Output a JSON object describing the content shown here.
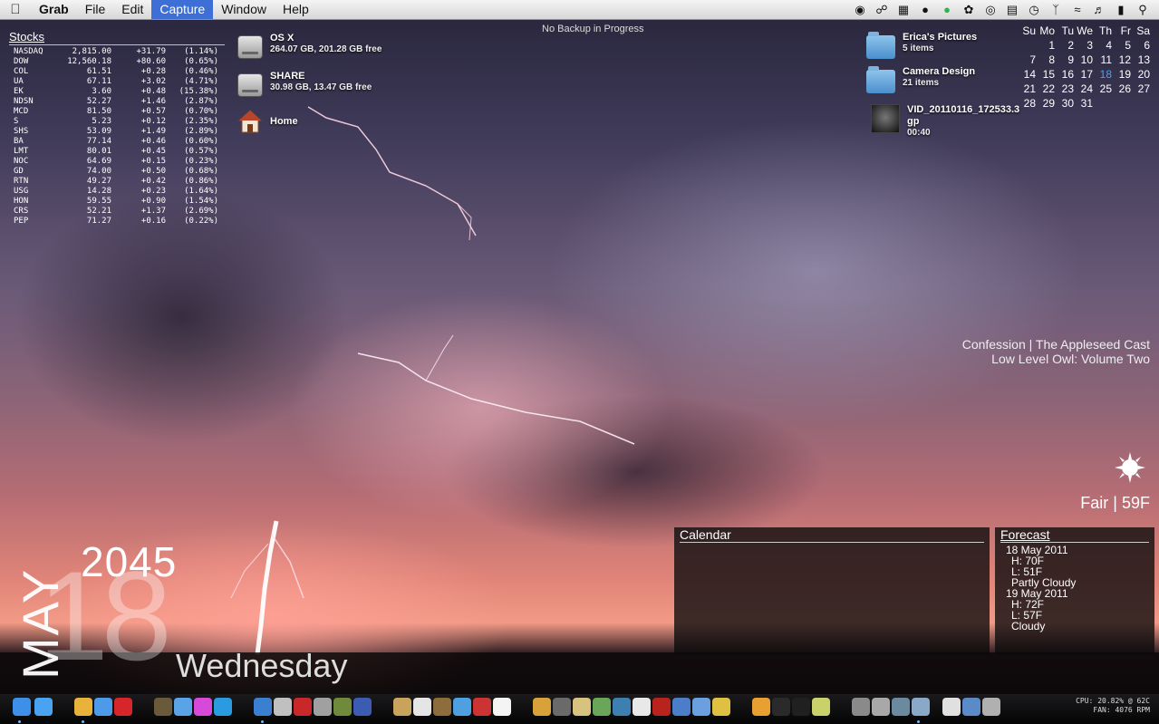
{
  "menubar": {
    "items": [
      "Grab",
      "File",
      "Edit",
      "Capture",
      "Window",
      "Help"
    ],
    "active_item": "Capture"
  },
  "backup_status": "No Backup in Progress",
  "stocks": {
    "title": "Stocks",
    "rows": [
      {
        "symbol": "NASDAQ",
        "price": "2,815.00",
        "change": "+31.79",
        "percent": "(1.14%)"
      },
      {
        "symbol": "DOW",
        "price": "12,560.18",
        "change": "+80.60",
        "percent": "(0.65%)"
      },
      {
        "symbol": "COL",
        "price": "61.51",
        "change": "+0.28",
        "percent": "(0.46%)"
      },
      {
        "symbol": "UA",
        "price": "67.11",
        "change": "+3.02",
        "percent": "(4.71%)"
      },
      {
        "symbol": "EK",
        "price": "3.60",
        "change": "+0.48",
        "percent": "(15.38%)"
      },
      {
        "symbol": "NDSN",
        "price": "52.27",
        "change": "+1.46",
        "percent": "(2.87%)"
      },
      {
        "symbol": "MCD",
        "price": "81.50",
        "change": "+0.57",
        "percent": "(0.70%)"
      },
      {
        "symbol": "S",
        "price": "5.23",
        "change": "+0.12",
        "percent": "(2.35%)"
      },
      {
        "symbol": "SHS",
        "price": "53.09",
        "change": "+1.49",
        "percent": "(2.89%)"
      },
      {
        "symbol": "BA",
        "price": "77.14",
        "change": "+0.46",
        "percent": "(0.60%)"
      },
      {
        "symbol": "LMT",
        "price": "80.01",
        "change": "+0.45",
        "percent": "(0.57%)"
      },
      {
        "symbol": "NOC",
        "price": "64.69",
        "change": "+0.15",
        "percent": "(0.23%)"
      },
      {
        "symbol": "GD",
        "price": "74.00",
        "change": "+0.50",
        "percent": "(0.68%)"
      },
      {
        "symbol": "RTN",
        "price": "49.27",
        "change": "+0.42",
        "percent": "(0.86%)"
      },
      {
        "symbol": "USG",
        "price": "14.28",
        "change": "+0.23",
        "percent": "(1.64%)"
      },
      {
        "symbol": "HON",
        "price": "59.55",
        "change": "+0.90",
        "percent": "(1.54%)"
      },
      {
        "symbol": "CRS",
        "price": "52.21",
        "change": "+1.37",
        "percent": "(2.69%)"
      },
      {
        "symbol": "PEP",
        "price": "71.27",
        "change": "+0.16",
        "percent": "(0.22%)"
      }
    ]
  },
  "desktop": {
    "osx": {
      "name": "OS X",
      "info": "264.07 GB, 201.28 GB free"
    },
    "share": {
      "name": "SHARE",
      "info": "30.98 GB, 13.47 GB free"
    },
    "home": {
      "name": "Home"
    },
    "ericas_pictures": {
      "name": "Erica's Pictures",
      "info": "5 items"
    },
    "camera_design": {
      "name": "Camera Design",
      "info": "21 items"
    },
    "video": {
      "name": "VID_20110116_172533.3gp",
      "info": "00:40"
    }
  },
  "calendar_grid": {
    "headers": [
      "Su",
      "Mo",
      "Tu",
      "We",
      "Th",
      "Fr",
      "Sa"
    ],
    "days": [
      "",
      "1",
      "2",
      "3",
      "4",
      "5",
      "6",
      "7",
      "8",
      "9",
      "10",
      "11",
      "12",
      "13",
      "14",
      "15",
      "16",
      "17",
      "18",
      "19",
      "20",
      "21",
      "22",
      "23",
      "24",
      "25",
      "26",
      "27",
      "28",
      "29",
      "30",
      "31"
    ],
    "today": "18",
    "today_color": "#39a7ff"
  },
  "now_playing": {
    "line1": "Confession | The Appleseed Cast",
    "line2": "Low Level Owl: Volume Two"
  },
  "weather": {
    "text": "Fair | 59F",
    "icon": "sun-icon"
  },
  "calendar_panel": {
    "title": "Calendar"
  },
  "forecast": {
    "title": "Forecast",
    "days": [
      {
        "date": "18 May 2011",
        "high": "H: 70F",
        "low": "L: 51F",
        "condition": "Partly Cloudy"
      },
      {
        "date": "19 May 2011",
        "high": "H: 72F",
        "low": "L: 57F",
        "condition": "Cloudy"
      }
    ]
  },
  "big_date": {
    "month": "MAY",
    "year": "2045",
    "day": "18",
    "weekday": "Wednesday"
  },
  "system_monitor": {
    "cpu": "CPU: 20.82% @ 62C",
    "fan": "FAN: 4076 RPM"
  },
  "dock": {
    "icons": [
      "finder-icon",
      "app-store-icon",
      "chrome-icon",
      "safari-icon",
      "opera-icon",
      "adium-icon",
      "ichat-icon",
      "itunes-icon-a",
      "skype-icon",
      "itunes-icon",
      "alfred-icon",
      "photo-booth-icon",
      "usb-drive-icon",
      "coda-icon",
      "migration-icon",
      "preview-icon",
      "pen-icon",
      "sketch-icon",
      "network-icon",
      "close-icon",
      "ical-icon",
      "iphoto-icon",
      "aperture-icon",
      "plane-icon",
      "map-icon",
      "maps-icon",
      "transmit-icon",
      "acrobat-icon",
      "feather-icon",
      "dvd-icon",
      "star-icon",
      "vlc-icon",
      "x11-icon",
      "terminal-icon",
      "stickies-icon",
      "utility-a-icon",
      "utility-b-icon",
      "disk-utility-icon",
      "mail-icon",
      "documents-icon",
      "downloads-icon",
      "trash-icon"
    ],
    "colors": [
      "#3d8fe8",
      "#4aa3f0",
      "#e9b23a",
      "#4d9be8",
      "#d6262c",
      "#6b5a3a",
      "#5aa3e6",
      "#d74ad9",
      "#2a9be0",
      "#3a7fd0",
      "#c0c0c0",
      "#c8282a",
      "#a0a0a0",
      "#6e8a3a",
      "#3b5cb0",
      "#c9a35b",
      "#e5e5e5",
      "#8e6d3c",
      "#4fa0e0",
      "#c33",
      "#f4f4f4",
      "#d9a13a",
      "#6a6a6a",
      "#d8c280",
      "#6aa65a",
      "#3d7fb0",
      "#e8e8e8",
      "#b8231e",
      "#4c7dc8",
      "#6aa0e0",
      "#e0c040",
      "#e8a030",
      "#2a2a2a",
      "#202020",
      "#c9d26a",
      "#8a8a8a",
      "#a8a8a8",
      "#6a8aa0",
      "#8aa8c8",
      "#e0e0e0",
      "#5a8ac8",
      "#b0b0b0"
    ]
  }
}
